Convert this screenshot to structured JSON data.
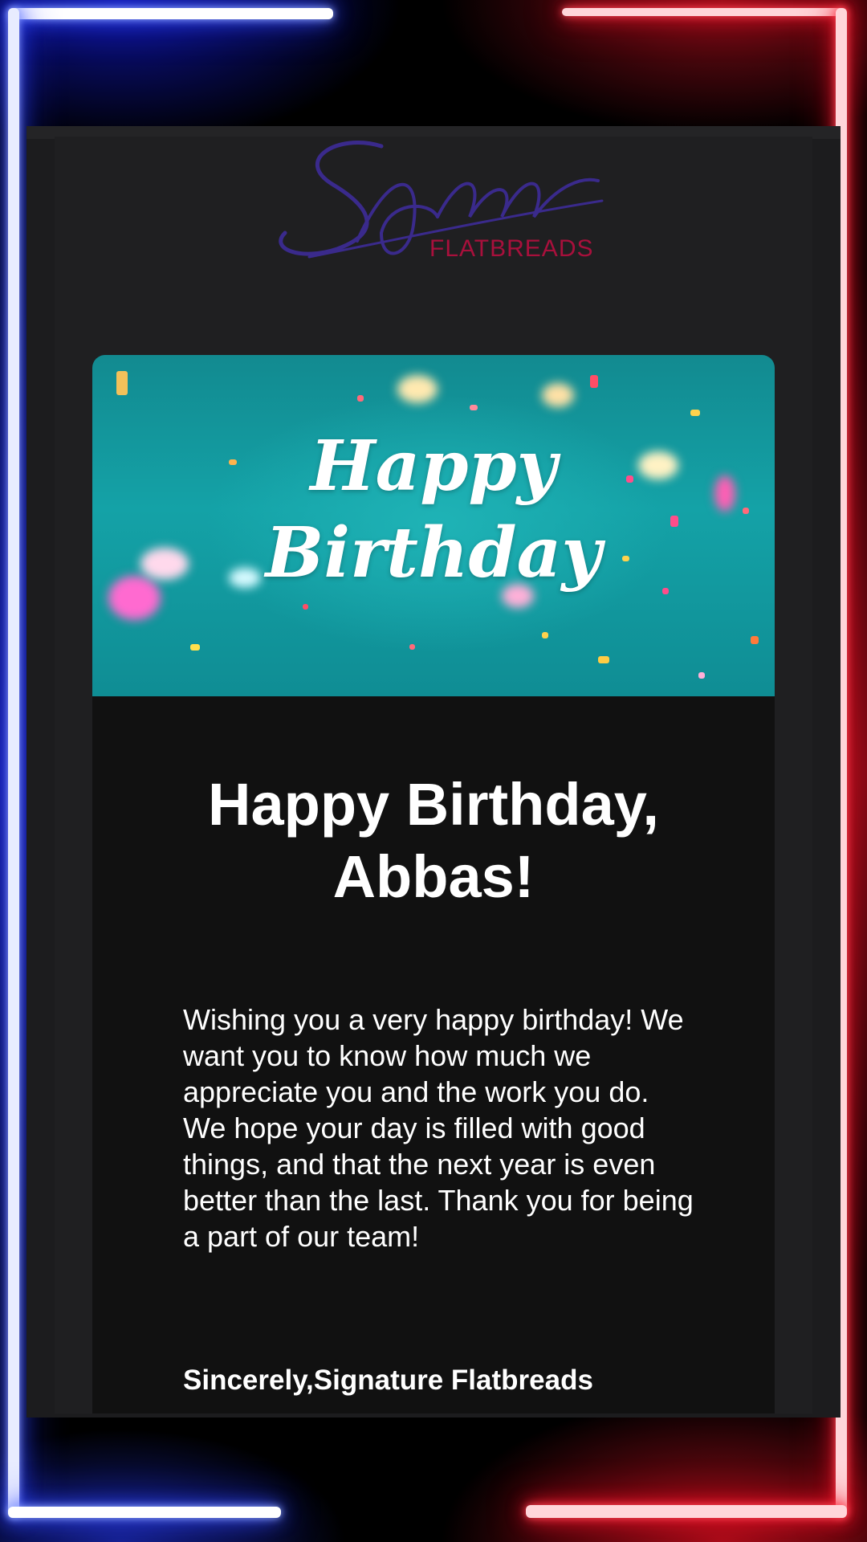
{
  "brand": {
    "logo_script": "Signature",
    "logo_sub": "FLATBREADS",
    "colors": {
      "script": "#3a2a8c",
      "sub": "#a8103c"
    }
  },
  "banner": {
    "title_line1": "Happy",
    "title_line2": "Birthday"
  },
  "email": {
    "headline_line1": "Happy Birthday,",
    "headline_line2": "Abbas!",
    "message": "Wishing you a very happy birthday! We want you to know how much we appreciate you and the work you do. We hope your day is filled with good things, and that the next year is even better than the last. Thank you for being a part of our team!",
    "signoff": "Sincerely,Signature Flatbreads"
  },
  "theme": {
    "neon_left": "#2f45ff",
    "neon_right": "#ff1a2e",
    "banner_teal": "#14a2a7"
  }
}
